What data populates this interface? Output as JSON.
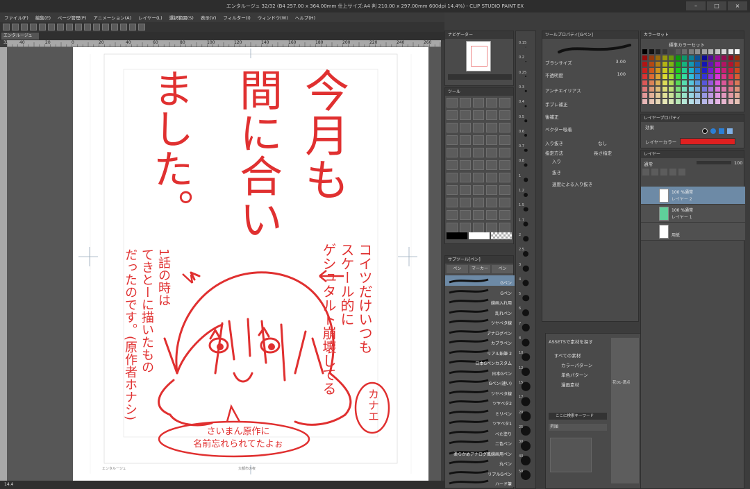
{
  "window": {
    "title": "エンタルージュ 32/32 (B4 257.00 x 364.00mm 仕上サイズ:A4 判 210.00 x 297.00mm 600dpi 14.4%) - CLIP STUDIO PAINT EX"
  },
  "menu": [
    "ファイル(F)",
    "編集(E)",
    "ページ管理(P)",
    "アニメーション(A)",
    "レイヤー(L)",
    "選択範囲(S)",
    "表示(V)",
    "フィルター(I)",
    "ウィンドウ(W)",
    "ヘルプ(H)"
  ],
  "document": {
    "tab": "エンタルージュ 32/32",
    "zoom": "14.4",
    "footer_left": "エンタルージュ",
    "footer_center": "大都市の夜"
  },
  "ruler": {
    "ticks": [
      "40",
      "20",
      "0",
      "20",
      "40",
      "60",
      "80",
      "100",
      "120",
      "140",
      "160",
      "180",
      "200",
      "220",
      "240",
      "260"
    ]
  },
  "artwork": {
    "title_cols": [
      "今月も",
      "間に合い",
      "ました。"
    ],
    "note_right": [
      "コイツだけいつも",
      "スケール的に",
      "ゲシュタルト崩壊してる"
    ],
    "note_left": [
      "1話の時は",
      "てきとーに描いたもの",
      "だったのです。(原作者ホナシ)"
    ],
    "name_tag": "カナエ",
    "speech": [
      "さいまん原作に",
      "名前忘れられてたよぉ"
    ],
    "ink_color": "#e03030"
  },
  "panels": {
    "navigator_tab": "ナビゲーター",
    "tool_tab": "ツール",
    "subtool_tab": "サブツール[ペン]",
    "subtool_groups": [
      "ペン",
      "マーカー",
      "ペン"
    ],
    "tool_property_tab": "ツールプロパティ[Gペン]",
    "color_set_tab": "カラーセット",
    "color_set_name": "標準カラーセット",
    "layer_property_tab": "レイヤープロパティ",
    "layer_tab": "レイヤー",
    "effect_label": "効果",
    "layer_color_label": "レイヤーカラー",
    "blend_mode": "通常",
    "opacity": "100"
  },
  "brushes": [
    "Gペン",
    "Gペン",
    "線画入れ用",
    "乱れペン",
    "ツヤベタ線",
    "アナログペン",
    "カブラペン",
    "リアル鉛筆 2",
    "日本Gペンカスタム",
    "日本Gペン",
    "Gペン(速い)",
    "ツヤベタ線",
    "ツヤベタ2",
    "ミリペン",
    "ツヤベタ1",
    "べた塗り",
    "二色ペン",
    "柔らかめアナログ風線画用ペン",
    "丸ペン",
    "リアルGペン",
    "ハード筆"
  ],
  "brush_sizes": [
    "0.15",
    "0.2",
    "0.25",
    "0.3",
    "0.4",
    "0.5",
    "0.6",
    "0.7",
    "0.8",
    "1",
    "1.2",
    "1.5",
    "1.7",
    "2",
    "2.5",
    "3",
    "4",
    "5",
    "6",
    "7",
    "8",
    "10",
    "12",
    "15",
    "17",
    "20",
    "25",
    "30",
    "40",
    "50"
  ],
  "tool_property": {
    "brush_size_label": "ブラシサイズ",
    "brush_size": "3.00",
    "opacity_label": "不透明度",
    "opacity": "100",
    "antialias_label": "アンチエイリアス",
    "stabilize_label": "手ブレ補正",
    "post_correction_label": "後補正",
    "vector_label": "ベクター吸着",
    "taper_label": "入り抜き",
    "taper_value": "なし",
    "method_label": "指定方法",
    "method_value": "長さ指定",
    "start_label": "入り",
    "end_label": "抜き",
    "speed_label": "速度による入り抜き"
  },
  "assets": {
    "header": "ASSETSで素材を探す",
    "items": [
      "すべての素材",
      "カラーパターン",
      "単色パターン",
      "漫画素材"
    ],
    "search_placeholder": "ここに検索キーワード",
    "sort_label": "昇順",
    "preview_label": "花01-満点"
  },
  "layers": [
    {
      "blend": "100 %通常",
      "name": "レイヤー 2",
      "selected": true
    },
    {
      "blend": "100 %通常",
      "name": "レイヤー 1",
      "selected": false
    },
    {
      "blend": "",
      "name": "用紙",
      "selected": false
    }
  ],
  "colors": {
    "accent": "#e03030",
    "layer_color": "#e02020",
    "selected_layer": "#6d8aa6",
    "layer_green": "#5fcf9a"
  }
}
